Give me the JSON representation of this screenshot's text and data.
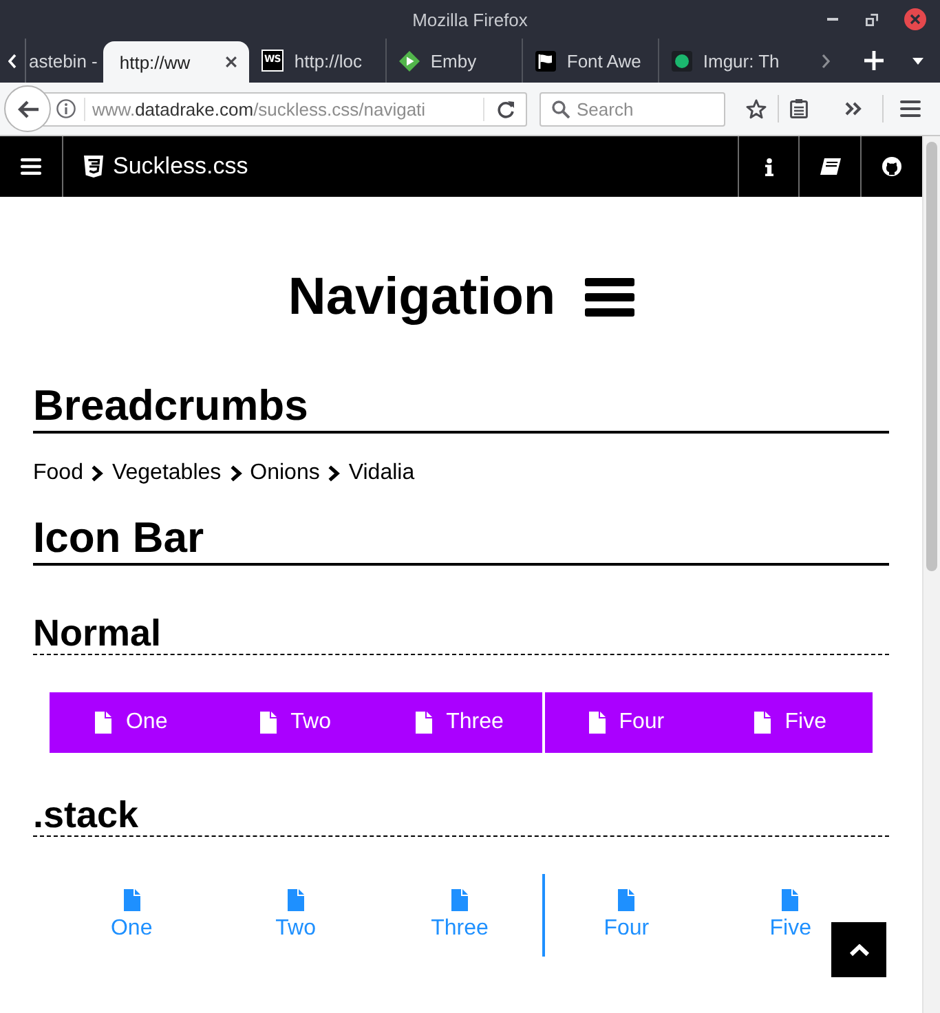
{
  "window": {
    "title": "Mozilla Firefox"
  },
  "tabs": [
    {
      "label": "astebin -",
      "kind": "plain",
      "selected": false
    },
    {
      "label": "http://ww",
      "kind": "plain",
      "selected": true
    },
    {
      "label": "http://loc",
      "kind": "badge",
      "badge": "WS",
      "selected": false
    },
    {
      "label": "Emby",
      "kind": "play",
      "selected": false
    },
    {
      "label": "Font Awe",
      "kind": "flag",
      "selected": false
    },
    {
      "label": "Imgur: Th",
      "kind": "dot",
      "selected": false
    }
  ],
  "address_bar": {
    "url_prefix": "www.",
    "url_domain": "datadrake.com",
    "url_path": "/suckless.css/navigati"
  },
  "search": {
    "placeholder": "Search"
  },
  "site_header": {
    "brand": "Suckless.css"
  },
  "page": {
    "title": "Navigation",
    "content": [
      {
        "kind": "section_heading",
        "text": "Breadcrumbs"
      },
      {
        "kind": "breadcrumbs",
        "items": [
          "Food",
          "Vegetables",
          "Onions",
          "Vidalia"
        ]
      },
      {
        "kind": "section_heading",
        "text": "Icon Bar"
      },
      {
        "kind": "subheading",
        "text": "Normal"
      },
      {
        "kind": "icon_bar",
        "groups": [
          {
            "items": [
              "One",
              "Two",
              "Three"
            ]
          },
          {
            "items": [
              "Four",
              "Five"
            ]
          }
        ]
      },
      {
        "kind": "subheading",
        "text": ".stack"
      },
      {
        "kind": "stacked_icon_bar",
        "groups": [
          {
            "items": [
              "One",
              "Two",
              "Three"
            ]
          },
          {
            "items": [
              "Four",
              "Five"
            ]
          }
        ]
      }
    ]
  }
}
